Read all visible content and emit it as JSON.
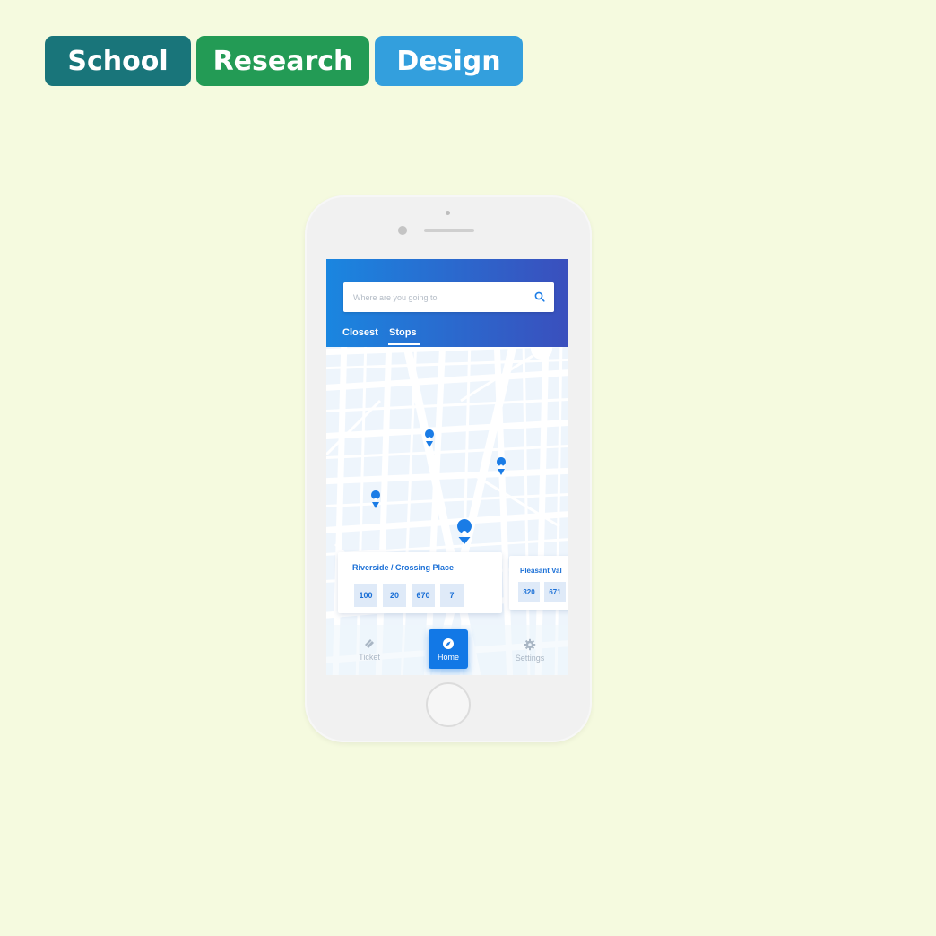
{
  "tags": [
    {
      "label": "School",
      "color": "#19757a"
    },
    {
      "label": "Research",
      "color": "#239b55"
    },
    {
      "label": "Design",
      "color": "#339fdd"
    }
  ],
  "app": {
    "search": {
      "placeholder": "Where are you going to",
      "icon": "search-icon"
    },
    "tabs": [
      {
        "label": "Closest",
        "active": false
      },
      {
        "label": "Stops",
        "active": true
      }
    ],
    "map_pins": 4,
    "stop_cards": [
      {
        "title": "Riverside / Crossing Place",
        "routes": [
          "100",
          "20",
          "670",
          "7"
        ]
      },
      {
        "title": "Pleasant Val",
        "routes": [
          "320",
          "671"
        ]
      }
    ],
    "nav": {
      "ticket": "Ticket",
      "home": "Home",
      "settings": "Settings"
    },
    "colors": {
      "accent": "#1278e6",
      "header_start": "#1a86e0",
      "header_end": "#3a4fbd",
      "map_bg": "#eef5fc"
    }
  }
}
